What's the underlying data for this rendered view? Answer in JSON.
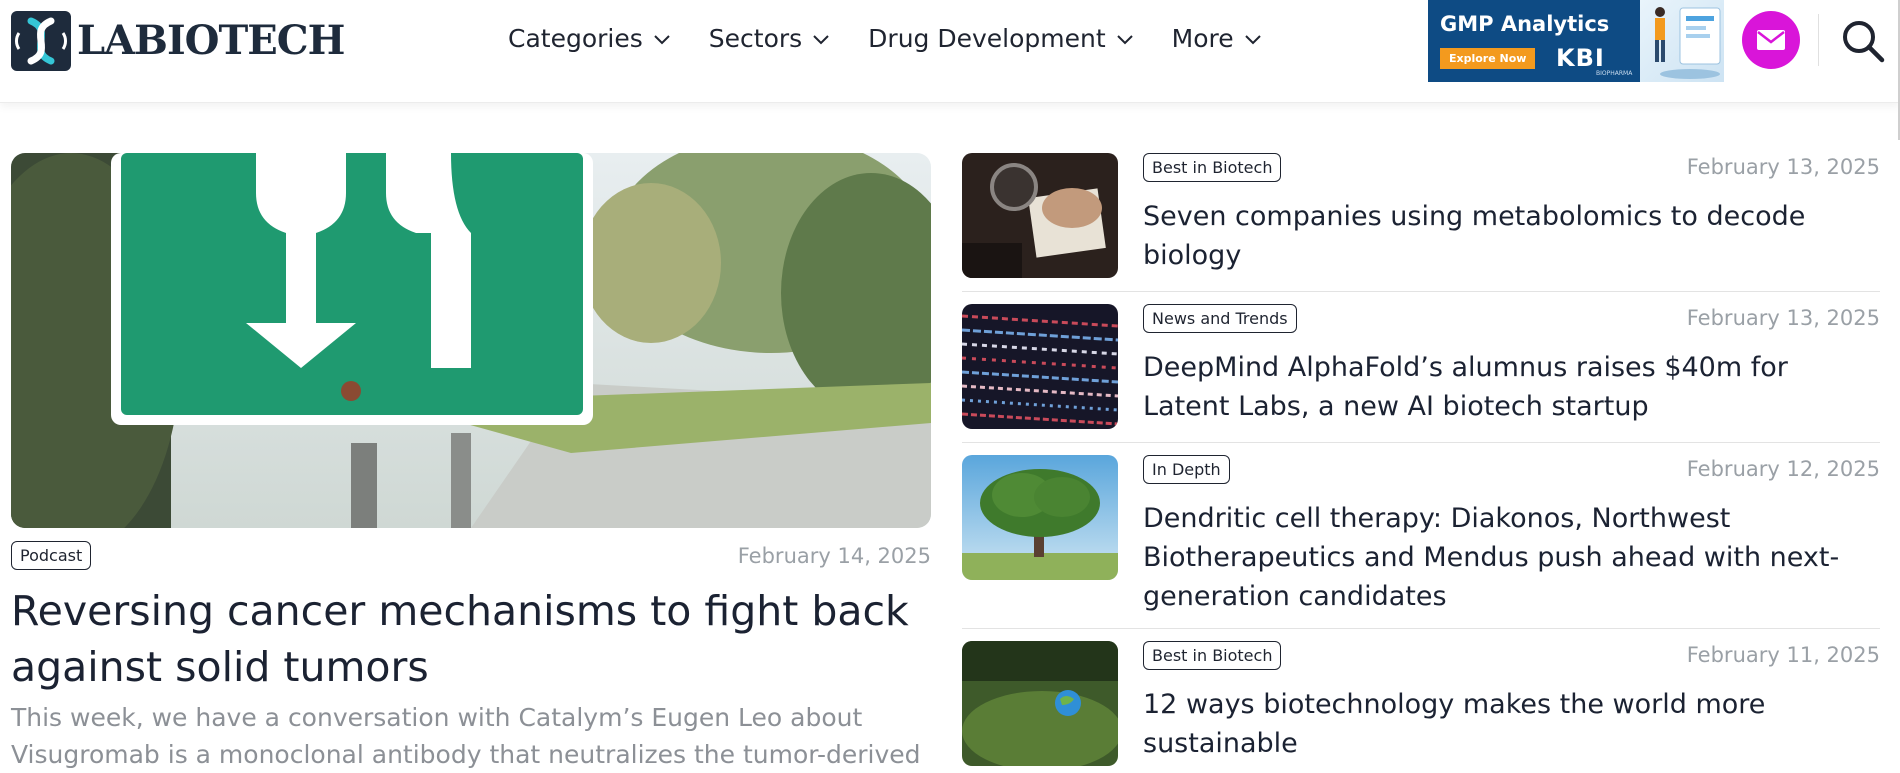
{
  "site": {
    "logo_text": "LABIOTECH"
  },
  "nav": {
    "items": [
      {
        "label": "Categories"
      },
      {
        "label": "Sectors"
      },
      {
        "label": "Drug Development"
      },
      {
        "label": "More"
      }
    ]
  },
  "ad": {
    "title": "GMP Analytics",
    "cta": "Explore Now",
    "brand": "KBI",
    "brand_sub": "BIOPHARMA"
  },
  "icons": {
    "mail": "envelope-icon",
    "search": "search-icon",
    "chevron": "chevron-down-icon"
  },
  "colors": {
    "brand_dark": "#1e2b3c",
    "mail_accent": "#d915d9",
    "date_gray": "#9aa0a6"
  },
  "featured": {
    "category": "Podcast",
    "date": "February 14, 2025",
    "title": "Reversing cancer mechanisms to fight back against solid tumors",
    "excerpt": "This week, we have a conversation with Catalym’s Eugen Leo about Visugromab is a monoclonal antibody that neutralizes the tumor-derived"
  },
  "articles": [
    {
      "category": "Best in Biotech",
      "date": "February 13, 2025",
      "title": "Seven companies using metabolomics to decode biology"
    },
    {
      "category": "News and Trends",
      "date": "February 13, 2025",
      "title": "DeepMind AlphaFold’s alumnus raises $40m for Latent Labs, a new AI biotech startup"
    },
    {
      "category": "In Depth",
      "date": "February 12, 2025",
      "title": "Dendritic cell therapy: Diakonos, Northwest Biotherapeutics and Mendus push ahead with next-generation candidates"
    },
    {
      "category": "Best in Biotech",
      "date": "February 11, 2025",
      "title": "12 ways biotechnology makes the world more sustainable"
    }
  ]
}
